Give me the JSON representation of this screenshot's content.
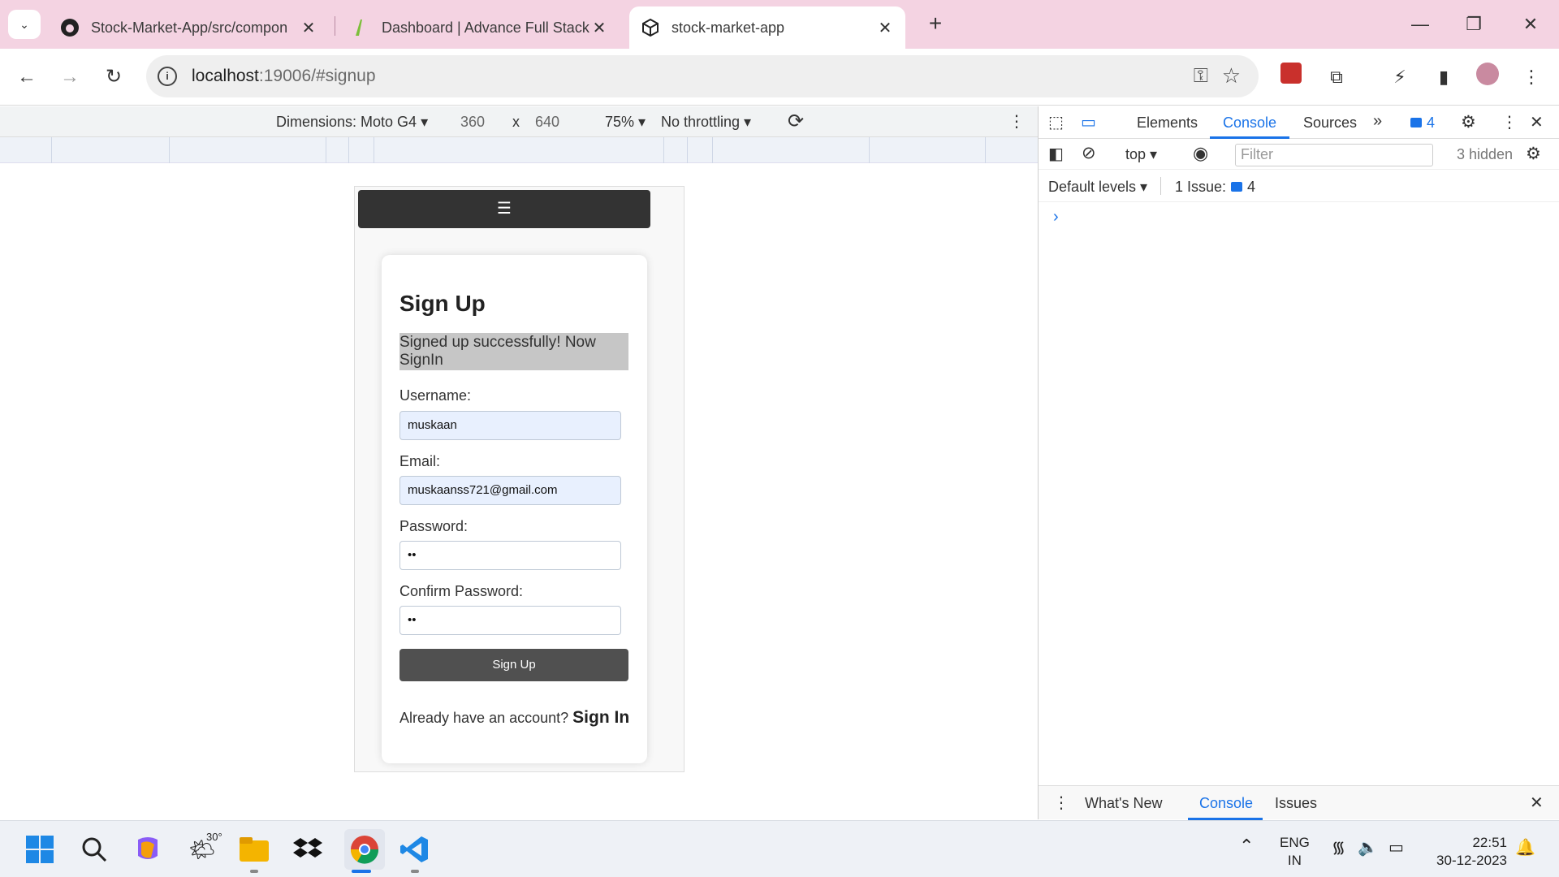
{
  "browser": {
    "tabs": [
      {
        "title": "Stock-Market-App/src/compon",
        "icon": "github-icon",
        "active": false
      },
      {
        "title": "Dashboard | Advance Full Stack",
        "icon": "leaf-icon",
        "active": false
      },
      {
        "title": "stock-market-app",
        "icon": "cube-icon",
        "active": true
      }
    ],
    "url_host": "localhost",
    "url_path": ":19006/#signup"
  },
  "device_toolbar": {
    "dimensions_label": "Dimensions: Moto G4 ▾",
    "width": "360",
    "times": "x",
    "height": "640",
    "zoom": "75% ▾",
    "throttling": "No throttling ▾"
  },
  "page": {
    "menu_glyph": "☰",
    "heading": "Sign Up",
    "success_message": "Signed up successfully! Now SignIn",
    "username_label": "Username:",
    "username_value": "muskaan",
    "email_label": "Email:",
    "email_value": "muskaanss721@gmail.com",
    "password_label": "Password:",
    "password_value": "••",
    "confirm_label": "Confirm Password:",
    "confirm_value": "••",
    "submit_label": "Sign Up",
    "signin_prompt": "Already have an account?",
    "signin_link": "Sign In"
  },
  "devtools": {
    "tabs": {
      "elements": "Elements",
      "console": "Console",
      "sources": "Sources"
    },
    "issue_count_badge": "4",
    "context": "top ▾",
    "filter_placeholder": "Filter",
    "hidden": "3 hidden",
    "levels": "Default levels ▾",
    "issues_label": "1 Issue:",
    "issues_count": "4",
    "prompt": "›",
    "drawer_tabs": {
      "whats_new": "What's New",
      "console": "Console",
      "issues": "Issues"
    }
  },
  "taskbar": {
    "weather_temp": "30°",
    "lang_top": "ENG",
    "lang_bottom": "IN",
    "time": "22:51",
    "date": "30-12-2023"
  }
}
